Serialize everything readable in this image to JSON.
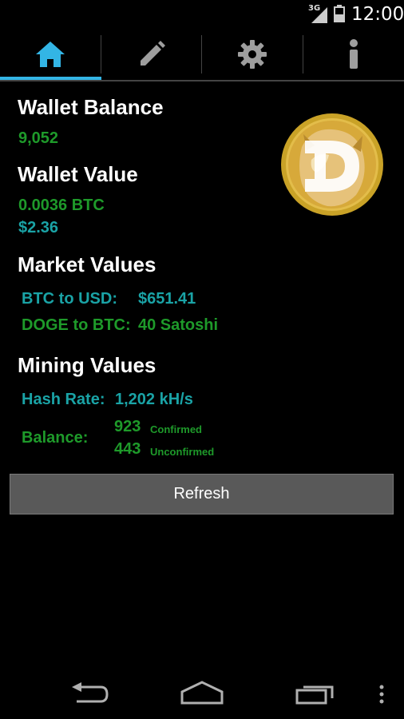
{
  "status_bar": {
    "network": "3G",
    "time": "12:00"
  },
  "tabs": [
    {
      "name": "home",
      "icon": "home-icon",
      "active": true
    },
    {
      "name": "edit",
      "icon": "pencil-icon",
      "active": false
    },
    {
      "name": "settings",
      "icon": "gear-icon",
      "active": false
    },
    {
      "name": "info",
      "icon": "info-icon",
      "active": false
    }
  ],
  "wallet_balance": {
    "title": "Wallet Balance",
    "value": "9,052"
  },
  "wallet_value": {
    "title": "Wallet Value",
    "btc": "0.0036 BTC",
    "usd": "$2.36"
  },
  "market_values": {
    "title": "Market Values",
    "btc_usd_label": "BTC to USD:",
    "btc_usd_value": "$651.41",
    "doge_btc_label": "DOGE to BTC:",
    "doge_btc_value": "40 Satoshi"
  },
  "mining_values": {
    "title": "Mining Values",
    "hash_rate_label": "Hash Rate:",
    "hash_rate_value": "1,202 kH/s",
    "balance_label": "Balance:",
    "confirmed_value": "923",
    "confirmed_label": "Confirmed",
    "unconfirmed_value": "443",
    "unconfirmed_label": "Unconfirmed"
  },
  "refresh_button": {
    "label": "Refresh"
  },
  "colors": {
    "accent": "#33b5e5",
    "green": "#1e9a2a",
    "teal": "#1aa3a6",
    "button": "#595959"
  }
}
